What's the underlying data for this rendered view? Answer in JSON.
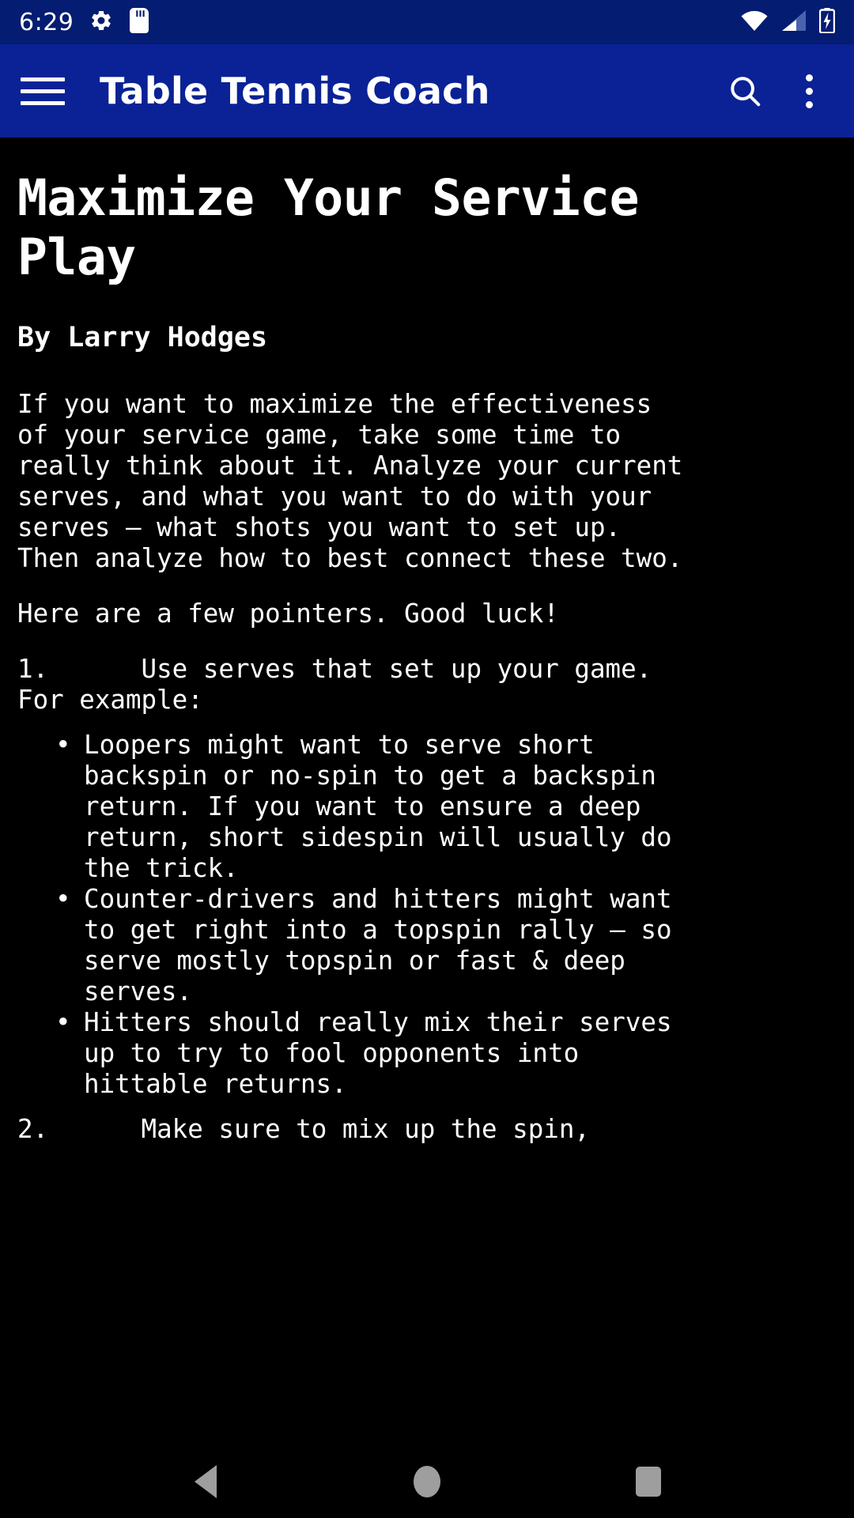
{
  "status_bar": {
    "clock": "6:29",
    "left_icons": [
      {
        "name": "settings-gear-icon"
      },
      {
        "name": "sd-card-icon"
      }
    ],
    "right_icons": [
      {
        "name": "wifi-icon"
      },
      {
        "name": "cellular-signal-icon"
      },
      {
        "name": "battery-charging-icon"
      }
    ],
    "background_color": "#041c71"
  },
  "app_bar": {
    "title": "Table Tennis Coach",
    "menu_icon": "hamburger-menu-icon",
    "search_icon": "search-icon",
    "overflow_icon": "more-vertical-icon",
    "background_color": "#0a2296",
    "text_color": "#ffffff"
  },
  "article": {
    "title": "Maximize Your Service\nPlay",
    "author": "By Larry Hodges",
    "paragraph_1": "If you want to maximize the effectiveness\nof your service game, take some time to\nreally think about it. Analyze your current\nserves, and what you want to do with your\nserves – what shots you want to set up.\nThen analyze how to best connect these two.",
    "paragraph_2": "Here are a few pointers. Good luck!",
    "item_1": "1.\tUse serves that set up your game.\nFor example:",
    "bullets": [
      "Loopers might want to serve short\nbackspin or no-spin to get a backspin\nreturn. If you want to ensure a deep\nreturn, short sidespin will usually do\nthe trick.",
      "Counter-drivers and hitters might want\nto get right into a topspin rally – so\nserve mostly topspin or fast & deep\nserves.",
      "Hitters should really mix their serves\nup to try to fool opponents into\nhittable returns."
    ],
    "item_2": "2.\tMake sure to mix up the spin,",
    "background_color": "#000000",
    "text_color": "#ffffff"
  },
  "nav_bar": {
    "back_label": "back-button",
    "home_label": "home-button",
    "recents_label": "recents-button",
    "icon_color": "#9e9e9e"
  }
}
